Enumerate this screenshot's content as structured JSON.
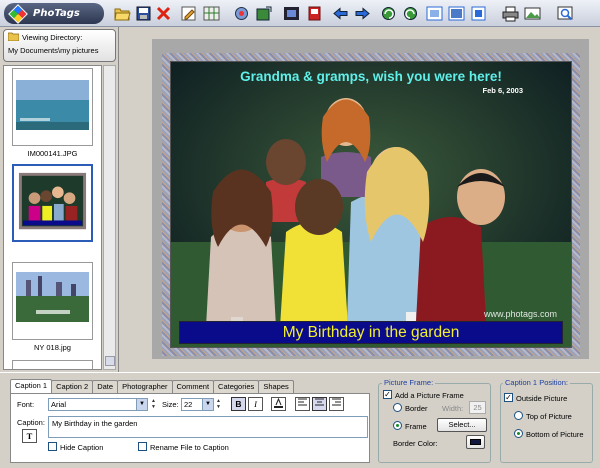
{
  "app": {
    "title": "PhoTags"
  },
  "toolbar": {
    "icons": [
      "open-folder-icon",
      "save-icon",
      "delete-icon",
      "edit-icon",
      "grid-view-icon",
      "settings-icon",
      "export-icon",
      "film-icon",
      "book-icon",
      "back-arrow-icon",
      "forward-arrow-icon",
      "rotate-left-icon",
      "rotate-right-icon",
      "resize-icon",
      "crop-icon",
      "fit-icon",
      "print-icon",
      "image-icon",
      "zoom-icon"
    ]
  },
  "sidebar": {
    "viewing_label": "Viewing Directory:",
    "directory": "My Documents\\my pictures",
    "thumbnails": [
      {
        "label": "IM000141.JPG",
        "selected": false
      },
      {
        "label": "",
        "selected": true
      },
      {
        "label": "NY 018.jpg",
        "selected": false
      }
    ]
  },
  "preview": {
    "top_caption": "Grandma & gramps, wish you were here!",
    "date": "Feb 6, 2003",
    "watermark": "www.photags.com",
    "bottom_caption": "My Birthday in the garden",
    "colors": {
      "top_caption": "#5ff0ea",
      "bottom_caption_text": "#f2ef2d",
      "bottom_caption_bg": "#0a0b8a"
    }
  },
  "caption_panel": {
    "tabs": [
      "Caption 1",
      "Caption 2",
      "Date",
      "Photographer",
      "Comment",
      "Categories",
      "Shapes"
    ],
    "active_tab": 0,
    "font_label": "Font:",
    "font_value": "Arial",
    "size_label": "Size:",
    "size_value": "22",
    "bold_label": "B",
    "italic_label": "I",
    "caption_label": "Caption:",
    "caption_text": "My Birthday in the garden",
    "text_button": "T",
    "hide_caption": "Hide Caption",
    "rename_file": "Rename File to Caption"
  },
  "picture_frame": {
    "title": "Picture Frame:",
    "add_frame": "Add a Picture Frame",
    "border": "Border",
    "width_label": "Width:",
    "width_value": "25",
    "frame": "Frame",
    "select_button": "Select...",
    "border_color_label": "Border Color:"
  },
  "caption_position": {
    "title": "Caption 1 Position:",
    "outside_picture": "Outside Picture",
    "top_of_picture": "Top of Picture",
    "bottom_of_picture": "Bottom of Picture"
  }
}
